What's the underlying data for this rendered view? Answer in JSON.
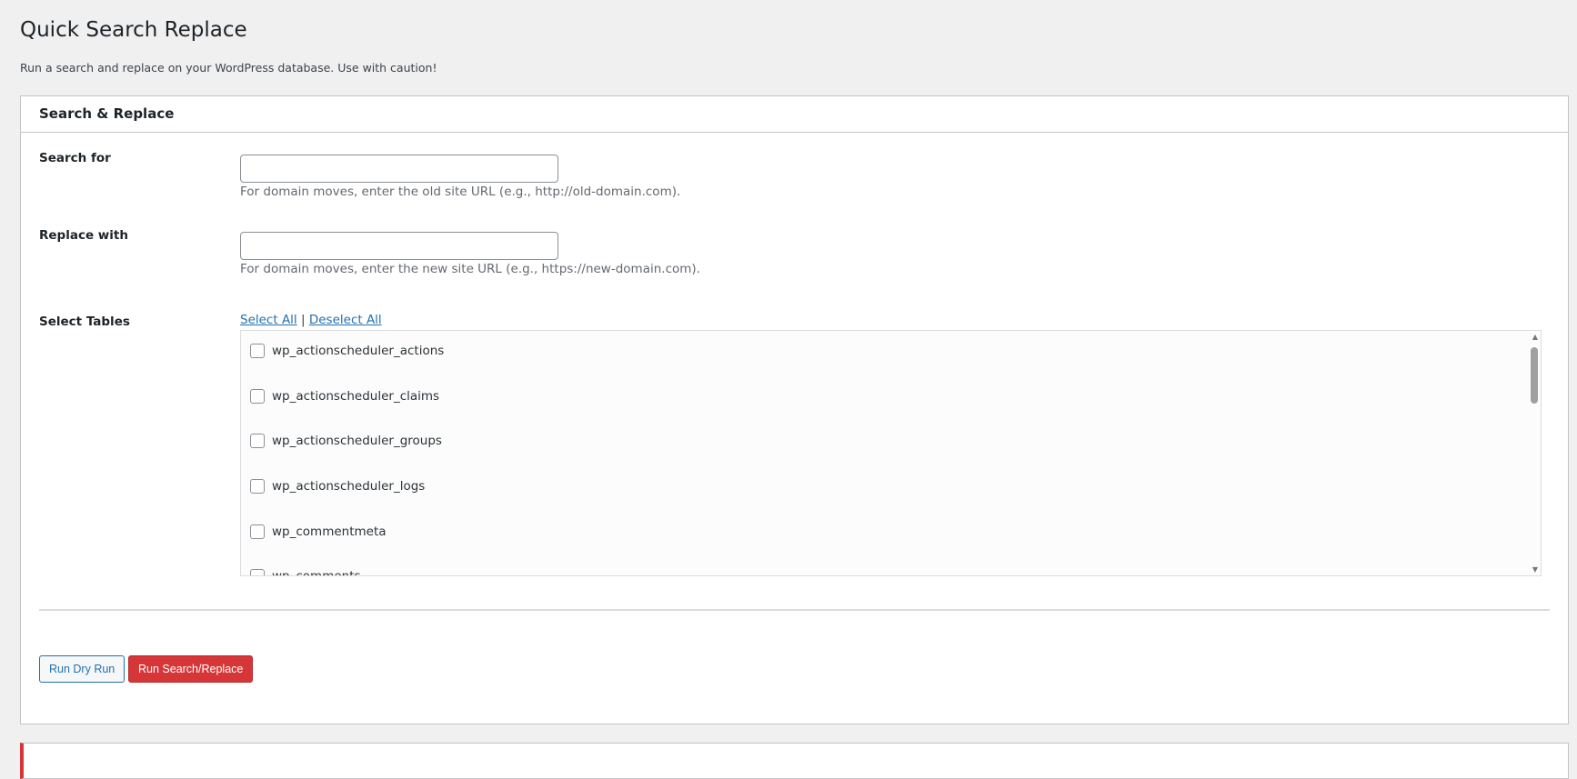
{
  "page": {
    "title": "Quick Search Replace",
    "description": "Run a search and replace on your WordPress database. Use with caution!"
  },
  "panel": {
    "title": "Search & Replace",
    "search": {
      "label": "Search for",
      "value": "",
      "help": "For domain moves, enter the old site URL (e.g., http://old-domain.com)."
    },
    "replace": {
      "label": "Replace with",
      "value": "",
      "help": "For domain moves, enter the new site URL (e.g., https://new-domain.com)."
    },
    "tables": {
      "label": "Select Tables",
      "select_all": "Select All",
      "separator": "|",
      "deselect_all": "Deselect All",
      "items": [
        "wp_actionscheduler_actions",
        "wp_actionscheduler_claims",
        "wp_actionscheduler_groups",
        "wp_actionscheduler_logs",
        "wp_commentmeta",
        "wp_comments"
      ]
    },
    "buttons": {
      "dry_run": "Run Dry Run",
      "run": "Run Search/Replace"
    }
  },
  "colors": {
    "accent": "#2271b1",
    "danger": "#d63638"
  }
}
